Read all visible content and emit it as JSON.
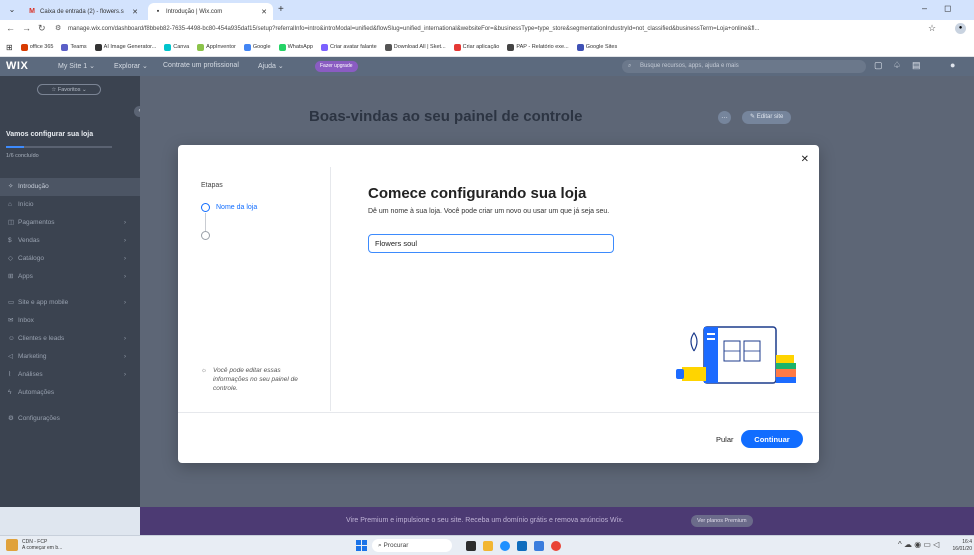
{
  "browser": {
    "tabs": [
      {
        "title": "Caixa de entrada (2) - flowers.s"
      },
      {
        "title": "Introdução | Wix.com"
      }
    ],
    "url": "manage.wix.com/dashboard/f8bbeb82-7635-4498-bc80-454a935daf15/setup?referralInfo=intro&introModal=unified&flowSlug=unified_international&websiteFor=&businessType=type_store&segmentationIndustryId=not_classified&businessTerm=Loja+online&fl...",
    "bookmarks": [
      {
        "label": "office 365",
        "color": "#d83b01"
      },
      {
        "label": "Teams",
        "color": "#5b5fc7"
      },
      {
        "label": "AI Image Generator...",
        "color": "#333333"
      },
      {
        "label": "Canva",
        "color": "#00c4cc"
      },
      {
        "label": "AppInventor",
        "color": "#8bc34a"
      },
      {
        "label": "Google",
        "color": "#4285f4"
      },
      {
        "label": "WhatsApp",
        "color": "#25d366"
      },
      {
        "label": "Criar avatar falante",
        "color": "#7b61ff"
      },
      {
        "label": "Download All | Sket...",
        "color": "#555555"
      },
      {
        "label": "Criar aplicação",
        "color": "#e53935"
      },
      {
        "label": "PAP - Relatório exe...",
        "color": "#444444"
      },
      {
        "label": "Google Sites",
        "color": "#3f51b5"
      }
    ]
  },
  "wix": {
    "logo": "WIX",
    "site": "My Site 1 ⌄",
    "menu": [
      "Explorar ⌄",
      "Contrate um profissional",
      "Ajuda ⌄"
    ],
    "upgrade": "Fazer upgrade",
    "search_placeholder": "Busque recursos, apps, ajuda e mais",
    "favorites": "☆ Favoritos ⌄",
    "setup_title": "Vamos configurar sua loja",
    "setup_progress": 0.17,
    "setup_sub": "1/6 concluído",
    "nav": [
      {
        "label": "Introdução",
        "icon": "✧",
        "chev": "",
        "active": true
      },
      {
        "label": "Início",
        "icon": "⌂",
        "chev": ""
      },
      {
        "label": "Pagamentos",
        "icon": "◫",
        "chev": "›"
      },
      {
        "label": "Vendas",
        "icon": "$",
        "chev": "›"
      },
      {
        "label": "Catálogo",
        "icon": "◇",
        "chev": "›"
      },
      {
        "label": "Apps",
        "icon": "⊞",
        "chev": "›"
      }
    ],
    "nav2": [
      {
        "label": "Site e app mobile",
        "icon": "▭",
        "chev": "›"
      },
      {
        "label": "Inbox",
        "icon": "✉",
        "chev": ""
      },
      {
        "label": "Clientes e leads",
        "icon": "☺",
        "chev": "›"
      },
      {
        "label": "Marketing",
        "icon": "◁",
        "chev": "›"
      },
      {
        "label": "Análises",
        "icon": "⌇",
        "chev": "›"
      },
      {
        "label": "Automações",
        "icon": "ϟ",
        "chev": ""
      }
    ],
    "nav3": [
      {
        "label": "Configurações",
        "icon": "⚙",
        "chev": ""
      }
    ],
    "welcome": "Boas-vindas ao seu painel de controle",
    "edit_site": "✎ Editar site",
    "premium_text": "Vire Premium e impulsione o seu site. Receba um domínio grátis e remova anúncios Wix.",
    "premium_btn": "Ver planos Premium"
  },
  "modal": {
    "steps_title": "Etapas",
    "step1": "Nome da loja",
    "hint": "Você pode editar essas informações no seu painel de controle.",
    "title": "Comece configurando sua loja",
    "subtitle": "Dê um nome à sua loja. Você pode criar um novo ou usar um que já seja seu.",
    "store_name": "Flowers soul",
    "skip": "Pular",
    "continue": "Continuar"
  },
  "taskbar": {
    "weather_title": "CDN - FCP",
    "weather_sub": "A começar em b...",
    "search": "Procurar",
    "clock_time": "16:4",
    "clock_date": "16/01/20"
  }
}
